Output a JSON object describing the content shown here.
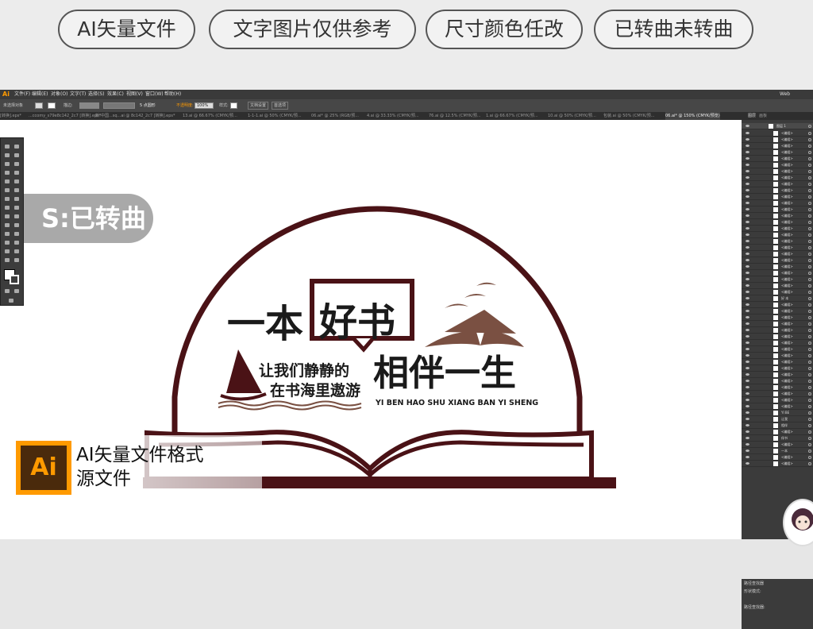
{
  "banner": {
    "pills": [
      "AI矢量文件",
      "文字图片仅供参考",
      "尺寸颜色任改",
      "已转曲未转曲"
    ]
  },
  "app": {
    "logo": "Ai",
    "menu": [
      "文件(F)",
      "编辑(E)",
      "对象(O)",
      "文字(T)",
      "选择(S)",
      "效果(C)",
      "视图(V)",
      "窗口(W)",
      "帮助(H)"
    ],
    "workspace": "Web",
    "control_bar": {
      "selection_label": "未选择对象",
      "stroke_label": "描边:",
      "points_label": "5 点圆形",
      "opacity_label": "不透明度:",
      "opacity_value": "100%",
      "style_label": "样式:",
      "doc_setup": "文档设置",
      "preferences": "首选项"
    },
    "doc_tabs": [
      "[转换].eps*",
      "...ccomy_s79e8c142_2c7 [转换].eps*",
      "新!中国...sq...ai @ 8c142_2c7 [转换].eps*",
      "13.ai @ 66.67% (CMYK/预...",
      "1-1-1.ai @ 50% (CMYK/预...",
      "06.ai* @ 25% (RGB/预...",
      "4.ai @ 33.33% (CMYK/预...",
      "76.ai @ 12.5% (CMYK/预...",
      "1.ai @ 66.67% (CMYK/预...",
      "10.ai @ 50% (CMYK/预...",
      "包装.ai @ 50% (CMYK/预...",
      "06.ai* @ 150% (CMYK/预览)"
    ],
    "panel_tabs": [
      "图层",
      "画板"
    ],
    "layer_root": "图层 1",
    "layers": [
      "<编组>",
      "<编组>",
      "<编组>",
      "<编组>",
      "<编组>",
      "<编组>",
      "<编组>",
      "<编组>",
      "<编组>",
      "<编组>",
      "<编组>",
      "<编组>",
      "<编组>",
      "<编组>",
      "<编组>",
      "<编组>",
      "<编组>",
      "<编组>",
      "<编组>",
      "<编组>",
      "<编组>",
      "<编组>",
      "<编组>",
      "<编组>",
      "<编组>",
      "<编组>",
      "好 本",
      "<编组>",
      "<编组>",
      "<编组>",
      "<编组>",
      "<编组>",
      "<编组>",
      "<编组>",
      "<编组>",
      "<编组>",
      "<编组>",
      "<编组>",
      "<编组>",
      "<编组>",
      "<编组>",
      "<编组>",
      "<编组>",
      "<编组>",
      "YI BE",
      "让我",
      "相伴",
      "<编组>",
      "伴书",
      "<编组>",
      "一本",
      "<编组>",
      "<编组>"
    ],
    "bottom_panel": {
      "title": "路径查找器",
      "shape_mode": "形状模式:",
      "finder": "路径查找器:"
    }
  },
  "artwork": {
    "badge": "S:已转曲",
    "title_left": "一本",
    "title_boxed": "好书",
    "slogan_line1": "让我们静静的",
    "slogan_line2": "在书海里遨游",
    "title_right": "相伴一生",
    "pinyin": "YI BEN HAO SHU XIANG BAN YI SHENG",
    "colors": {
      "primary": "#4a1216",
      "accent": "#7a5042"
    }
  },
  "footer": {
    "icon_text": "Ai",
    "caption_line1": "AI矢量文件格式",
    "caption_line2": "源文件"
  }
}
